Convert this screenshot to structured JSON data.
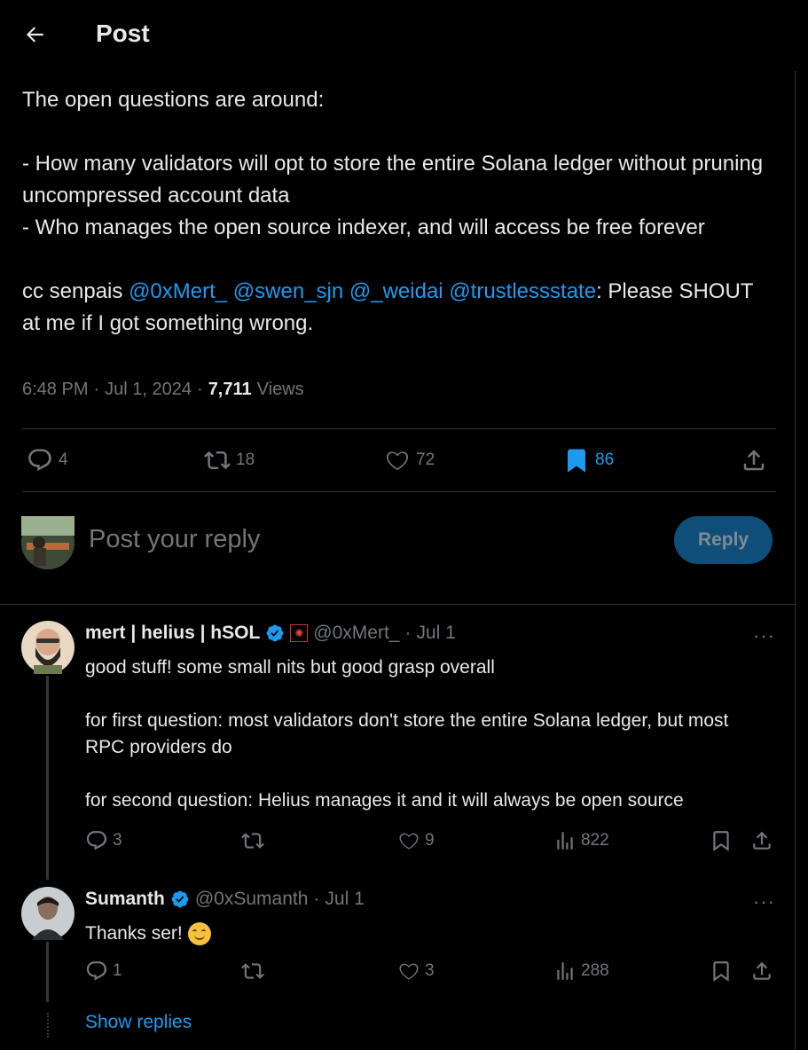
{
  "header": {
    "title": "Post"
  },
  "tweet": {
    "intro": "The open questions are around:",
    "bullet1": "- How many validators will opt to store the entire Solana ledger without pruning uncompressed account data",
    "bullet2": "- Who manages the open source indexer, and will access be free forever",
    "cc_prefix": "cc senpais ",
    "mentions": [
      "@0xMert_",
      "@swen_sjn",
      "@_weidai",
      "@trustlessstate"
    ],
    "cc_suffix": ": Please SHOUT at me if I got something wrong.",
    "time": "6:48 PM",
    "date": "Jul 1, 2024",
    "views_count": "7,711",
    "views_label": "Views",
    "stats": {
      "replies": "4",
      "reposts": "18",
      "likes": "72",
      "bookmarks": "86"
    }
  },
  "compose": {
    "placeholder": "Post your reply",
    "button": "Reply"
  },
  "replies": [
    {
      "name": "mert | helius | hSOL",
      "handle": "@0xMert_",
      "date": "Jul 1",
      "body": "good stuff! some small nits but good grasp overall\n\nfor first question: most validators don't store the entire Solana ledger, but most RPC providers do\n\nfor second question: Helius manages it and it will always be open source",
      "replies": "3",
      "likes": "9",
      "views": "822"
    },
    {
      "name": "Sumanth",
      "handle": "@0xSumanth",
      "date": "Jul 1",
      "body": "Thanks ser!",
      "replies": "1",
      "likes": "3",
      "views": "288"
    }
  ],
  "show_replies": "Show replies",
  "colors": {
    "accent": "#1d9bf0",
    "muted": "#71767b",
    "text": "#e7e9ea",
    "border": "#2f3336"
  }
}
